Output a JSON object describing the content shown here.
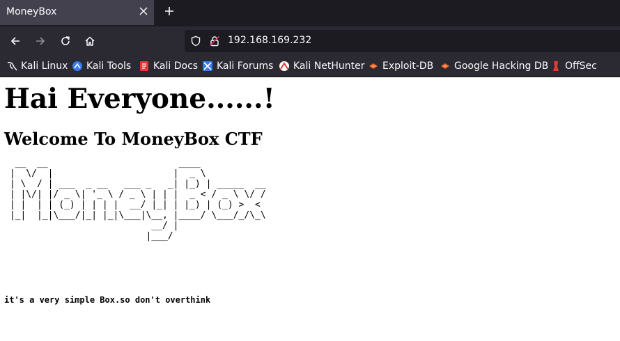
{
  "browser": {
    "tab": {
      "title": "MoneyBox",
      "close_icon": "close-icon"
    },
    "new_tab_icon": "plus-icon",
    "nav": {
      "back_icon": "arrow-left-icon",
      "forward_icon": "arrow-right-icon",
      "reload_icon": "reload-icon",
      "home_icon": "home-icon"
    },
    "url": "192.168.169.232",
    "bookmarks": [
      {
        "label": "Kali Linux",
        "icon": "kali-dragon-icon"
      },
      {
        "label": "Kali Tools",
        "icon": "kali-tools-icon"
      },
      {
        "label": "Kali Docs",
        "icon": "kali-docs-icon"
      },
      {
        "label": "Kali Forums",
        "icon": "kali-forums-icon"
      },
      {
        "label": "Kali NetHunter",
        "icon": "nethunter-icon"
      },
      {
        "label": "Exploit-DB",
        "icon": "exploit-db-icon"
      },
      {
        "label": "Google Hacking DB",
        "icon": "ghdb-icon"
      },
      {
        "label": "OffSec",
        "icon": "offsec-icon"
      }
    ]
  },
  "page": {
    "heading": "Hai Everyone......!",
    "subheading": "Welcome To MoneyBox CTF",
    "ascii_art": "  __  __                        ____\n |  \\/  |                      |  _ \\\n | \\  / | ___  _ __   ___ _   _| |_) | _____  __\n | |\\/| |/ _ \\| '_ \\ / _ \\ | | |  _ < / _ \\ \\/ /\n | |  | | (_) | | | |  __/ |_| | |_) | (_) >  <\n |_|  |_|\\___/|_| |_|\\___|\\__, |____/ \\___/_/\\_\\\n                           __/ |\n                          |___/",
    "note": "it's a very simple Box.so don't overthink"
  },
  "colors": {
    "tabbar_bg": "#1c1b22",
    "tab_active_bg": "#42414d",
    "toolbar_bg": "#2b2a33",
    "text_light": "#fbfbfe"
  }
}
